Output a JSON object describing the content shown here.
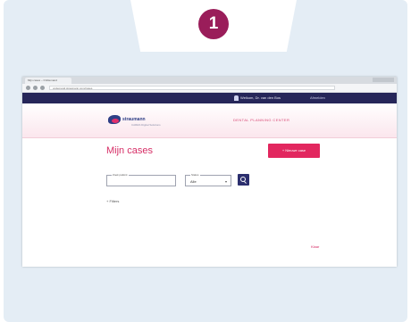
{
  "step": {
    "number": "1"
  },
  "browser": {
    "tab_title": "Mijn cases – OnDemand",
    "url": "ondemand.straumann.com/cases"
  },
  "site": {
    "user_name": "Welkom, Dr. van den Bos",
    "logout_label": "Afmelden",
    "logo_name": "straumann",
    "logo_sub": "CARES Digital Solutions",
    "header_caption": "DENTAL PLANNING CENTER"
  },
  "page": {
    "title": "Mijn cases",
    "new_case_button": "+ Nieuwe case",
    "search": {
      "label": "Zoek patiënt",
      "value": ""
    },
    "status_select": {
      "label": "Status",
      "value": "Alle"
    },
    "filters_link": "+ Filters",
    "done_link": "Klaar"
  }
}
